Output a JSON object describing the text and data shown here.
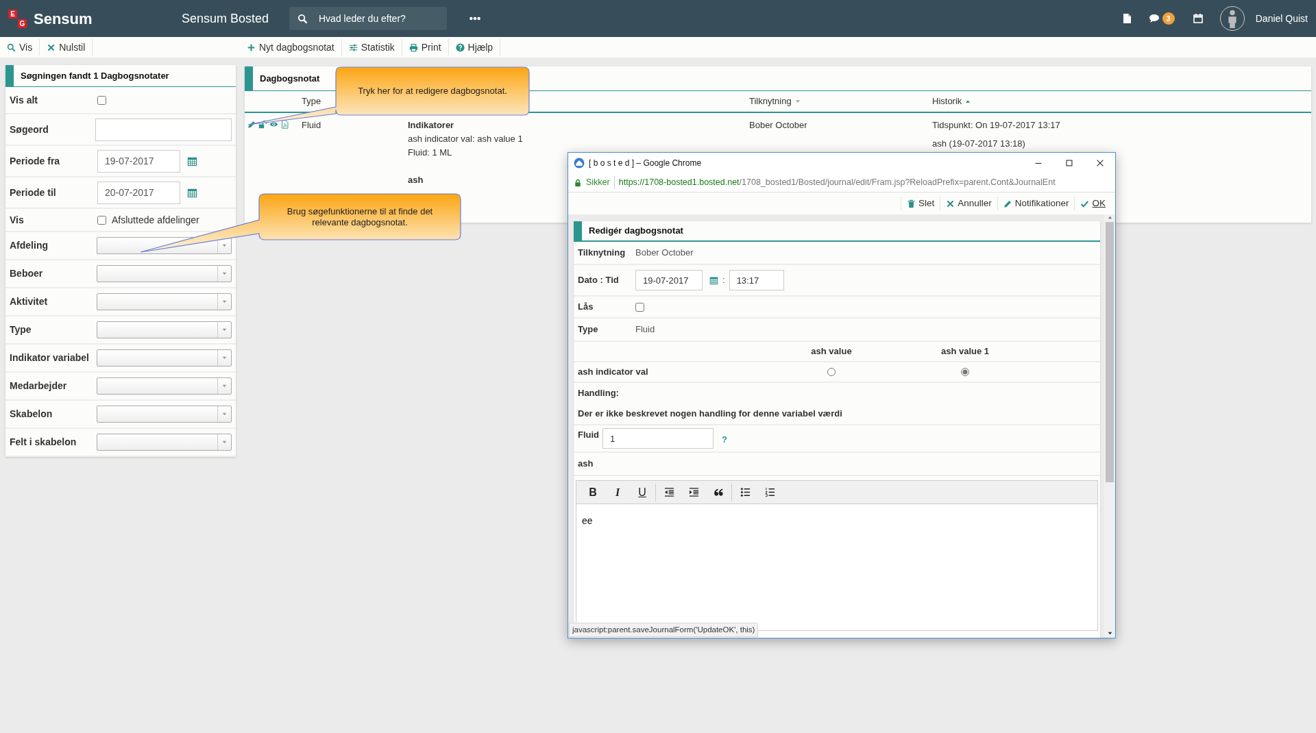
{
  "app": {
    "logo_mark": [
      "E",
      "G"
    ],
    "logo": "Sensum",
    "title": "Sensum Bosted",
    "search_placeholder": "Hvad leder du efter?",
    "notification_count": "3",
    "user": "Daniel Quist"
  },
  "toolbar": {
    "left": [
      {
        "kind": "search",
        "label": "Vis"
      },
      {
        "kind": "close",
        "label": "Nulstil"
      }
    ],
    "right": [
      {
        "kind": "plus",
        "label": "Nyt dagbogsnotat"
      },
      {
        "kind": "sliders",
        "label": "Statistik"
      },
      {
        "kind": "print",
        "label": "Print"
      },
      {
        "kind": "help",
        "label": "Hjælp"
      }
    ]
  },
  "search_panel": {
    "title": "Søgningen fandt 1 Dagbogsnotater",
    "fields": [
      {
        "kind": "checkbox",
        "label": "Vis alt",
        "checked": false
      },
      {
        "kind": "text",
        "label": "Søgeord"
      },
      {
        "kind": "date",
        "label": "Periode fra",
        "value": "19-07-2017"
      },
      {
        "kind": "date",
        "label": "Periode til",
        "value": "20-07-2017"
      },
      {
        "kind": "checkbox",
        "label": "Vis",
        "checked": false,
        "option": "Afsluttede afdelinger"
      },
      {
        "kind": "select",
        "label": "Afdeling"
      },
      {
        "kind": "select",
        "label": "Beboer"
      },
      {
        "kind": "select",
        "label": "Aktivitet"
      },
      {
        "kind": "select",
        "label": "Type"
      },
      {
        "kind": "select",
        "label": "Indikator variabel"
      },
      {
        "kind": "select",
        "label": "Medarbejder"
      },
      {
        "kind": "select",
        "label": "Skabelon"
      },
      {
        "kind": "select",
        "label": "Felt i skabelon"
      }
    ]
  },
  "journal": {
    "title": "Dagbogsnotat",
    "columns": [
      {
        "label": "Type"
      },
      {
        "label": "Tilknytning",
        "sorted": false,
        "ascending": false
      },
      {
        "label": "Historik",
        "sorted": true,
        "ascending": true
      }
    ],
    "rows": [
      {
        "type": "Fluid",
        "content_title": "Indikatorer",
        "content_lines": [
          "ash indicator val: ash value 1",
          "Fluid: 1 ML"
        ],
        "content_footer": "ash",
        "linked": "Bober October",
        "history": [
          "Tidspunkt: On 19-07-2017 13:17",
          "ash (19-07-2017 13:18)"
        ]
      }
    ]
  },
  "callouts": [
    {
      "text": "Tryk her for at redigere dagbogsnotat."
    },
    {
      "text": "Brug søgefunktionerne til at finde det relevante dagbogsnotat."
    }
  ],
  "popup": {
    "title": "[ b o s t e d ] – Google Chrome",
    "secure_label": "Sikker",
    "url_host": "https://1708-bosted1.bosted.net",
    "url_path": "/1708_bosted1/Bosted/journal/edit/Fram.jsp?ReloadPrefix=parent.Cont&JournalEnt",
    "actions": [
      {
        "kind": "delete",
        "label": "Slet"
      },
      {
        "kind": "cancel",
        "label": "Annuller"
      },
      {
        "kind": "edit",
        "label": "Notifikationer"
      },
      {
        "kind": "ok",
        "label": "OK"
      }
    ],
    "form_title": "Redigér dagbogsnotat",
    "linked_label": "Tilknytning",
    "linked_value": "Bober October",
    "datetime_label": "Dato : Tid",
    "date": "19-07-2017",
    "time_separator": ":",
    "time": "13:17",
    "lock_label": "Lås",
    "locked": false,
    "type_label": "Type",
    "type_value": "Fluid",
    "indicator": {
      "label": "ash indicator val",
      "options": [
        {
          "label": "ash value",
          "selected": false
        },
        {
          "label": "ash value 1",
          "selected": true
        }
      ]
    },
    "action_label": "Handling:",
    "action_text": "Der er ikke beskrevet nogen handling for denne variabel værdi",
    "fluid_label": "Fluid",
    "fluid_value": "1",
    "help": "?",
    "note_label": "ash",
    "editor_tools": [
      {
        "kind": "bold",
        "label": "B"
      },
      {
        "kind": "italic",
        "label": "I"
      },
      {
        "kind": "underline",
        "label": "U"
      },
      {
        "kind": "outdent"
      },
      {
        "kind": "indent"
      },
      {
        "kind": "quote"
      },
      {
        "kind": "bullets"
      },
      {
        "kind": "numbers"
      }
    ],
    "editor_text": "ee",
    "status_url": "javascript:parent.saveJournalForm('UpdateOK', this)"
  }
}
